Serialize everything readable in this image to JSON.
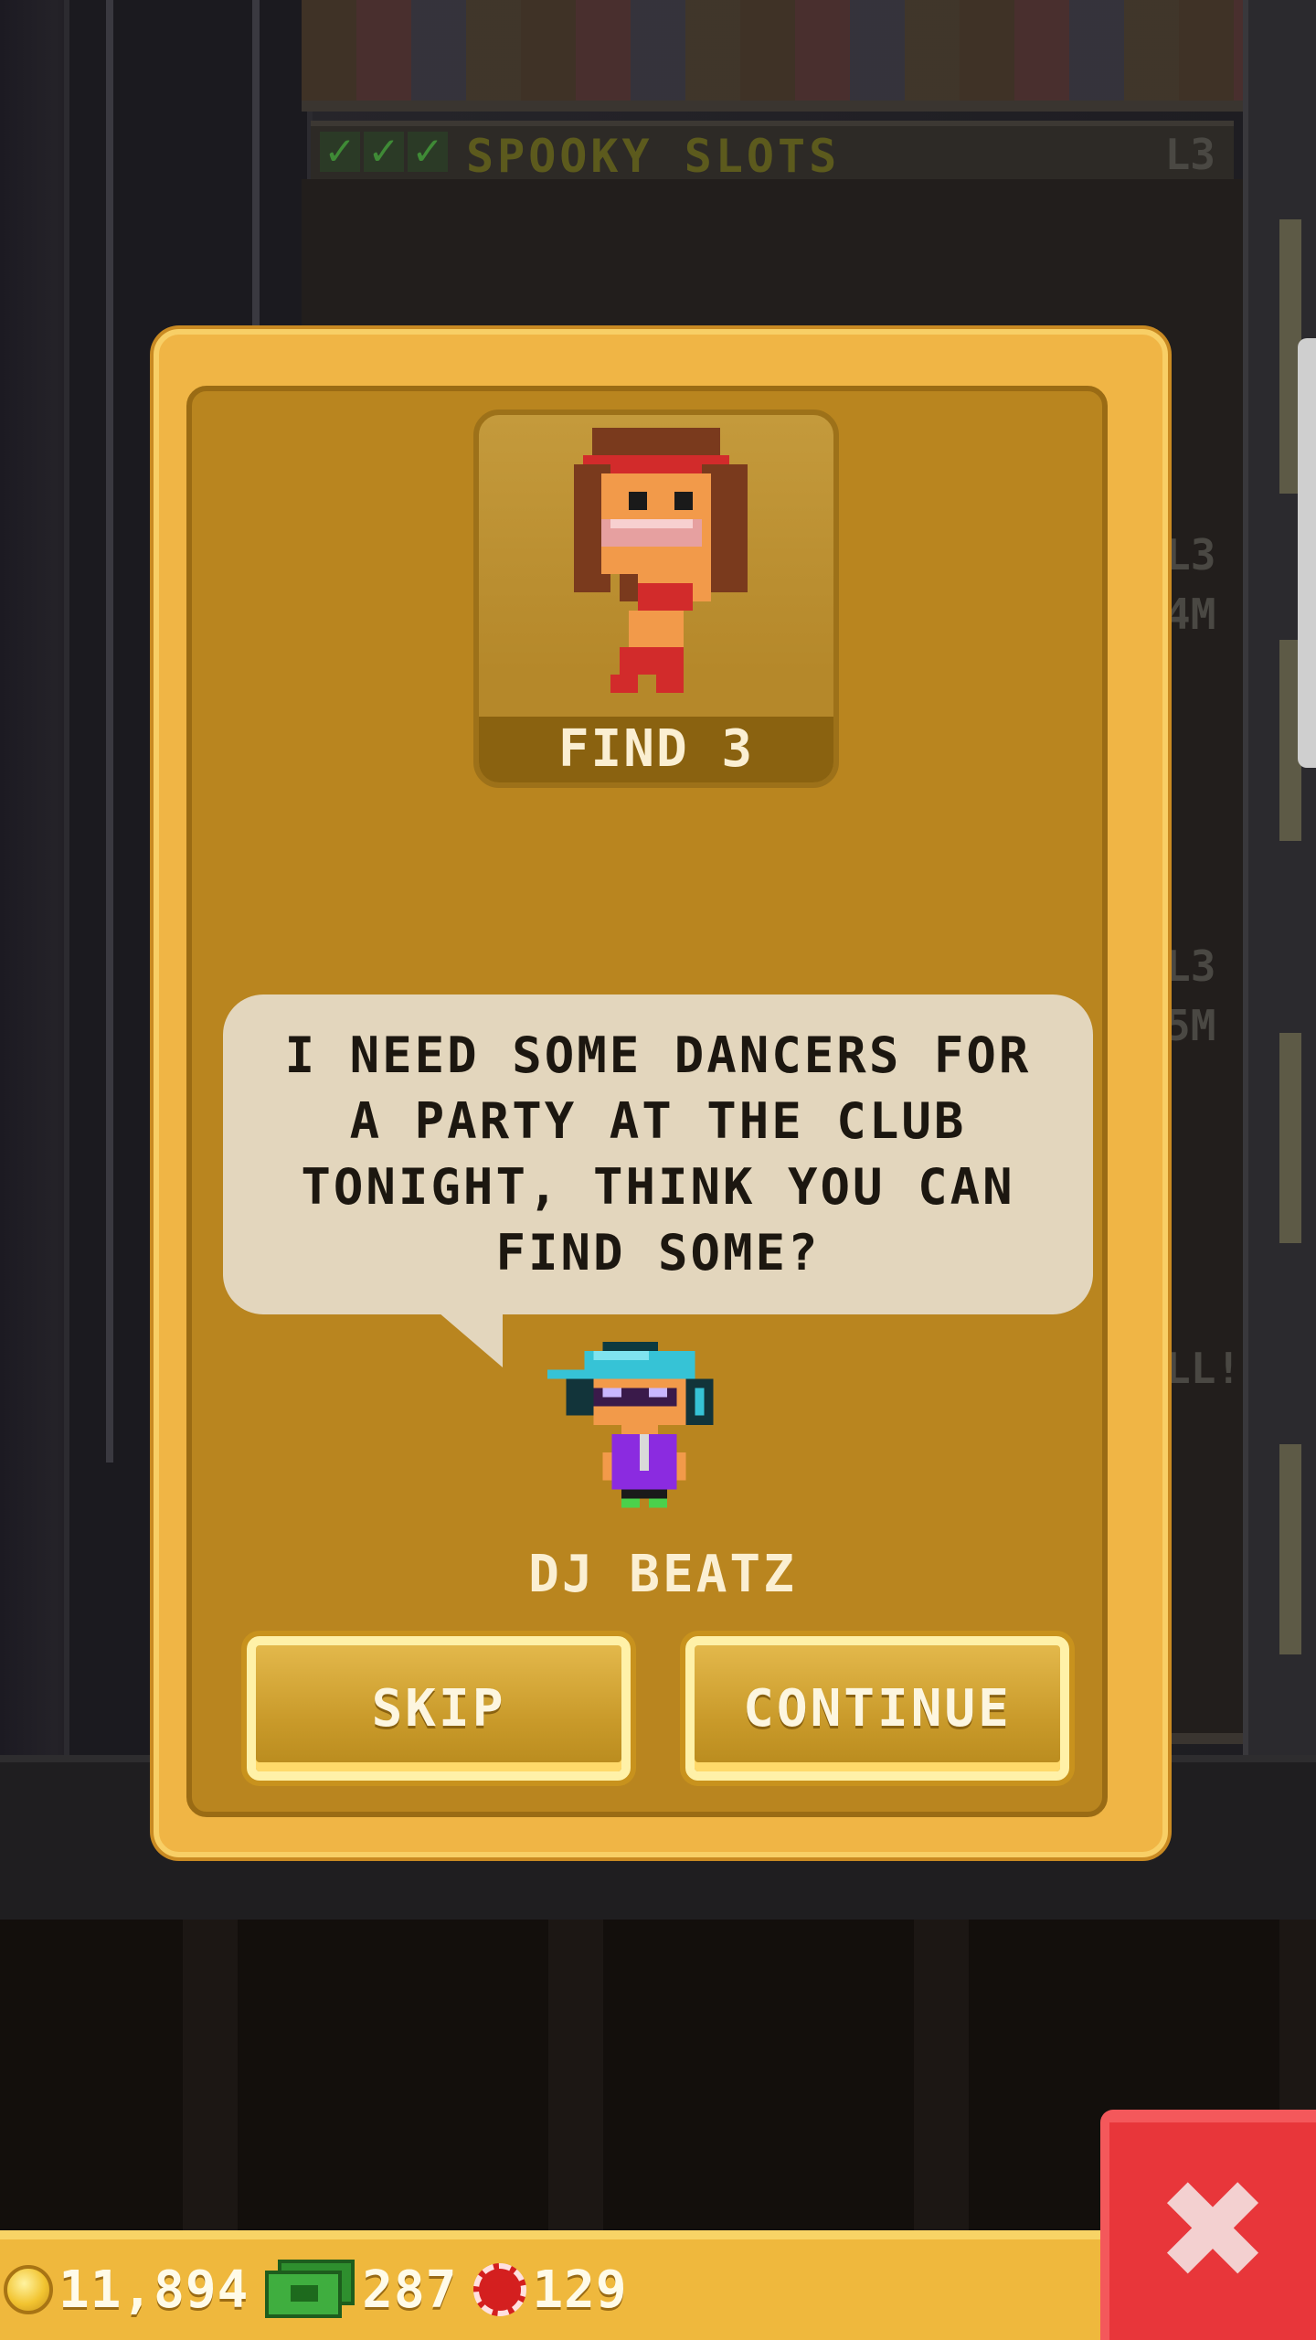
{
  "floor": {
    "name": "SPOOKY SLOTS",
    "level": "L3",
    "checks": [
      "✓",
      "✓",
      "✓"
    ],
    "side_tags": [
      "L3",
      "4M",
      "L3",
      "5M",
      "LL!"
    ]
  },
  "mission": {
    "target_label": "FIND 3",
    "dialog": "I NEED SOME DANCERS FOR\nA PARTY AT THE CLUB\nTONIGHT, THINK YOU CAN\nFIND SOME?",
    "npc_name": "DJ BEATZ",
    "skip_label": "SKIP",
    "continue_label": "CONTINUE"
  },
  "close_button": {
    "icon": "close-icon",
    "glyph": "✖"
  },
  "currency": {
    "coins": "11,894",
    "bux": "287",
    "chips": "129"
  },
  "colors": {
    "modal_outer": "#f0b545",
    "modal_inner": "#b9851f",
    "bubble": "#e3d6bd",
    "close": "#e8363a",
    "footer": "#efb83d"
  }
}
